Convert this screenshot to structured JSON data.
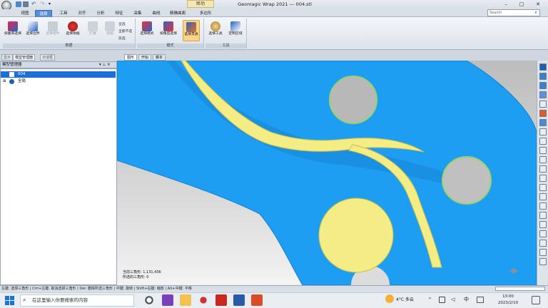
{
  "window": {
    "title": "Geomagic Wrap 2021 --- 004.stl",
    "context_tab": "赊功",
    "controls": [
      "–",
      "□",
      "✕"
    ]
  },
  "ribbon_tabs": [
    "视图",
    "选择",
    "工具",
    "对齐",
    "分析",
    "特征",
    "采集",
    "曲线",
    "精确曲面",
    "多边形"
  ],
  "active_tab": "选择",
  "search": {
    "placeholder": "Search"
  },
  "ribbon": {
    "groups": [
      {
        "label": "数据",
        "buttons": [
          "按曲率选择",
          "选择边界",
          "选择组件",
          "选择依据",
          "扩展",
          "收缩"
        ],
        "small": [
          "全选",
          "全部不选",
          "反选"
        ]
      },
      {
        "label": "模式",
        "buttons": [
          "选择模式",
          "按角度选择",
          "选择贯通"
        ]
      },
      {
        "label": "工具",
        "buttons": [
          "选择工具",
          "定制区域"
        ]
      }
    ]
  },
  "left_panel": {
    "tabs": [
      "显示",
      "模型管理器",
      "对话框"
    ],
    "header": "模型管理器",
    "items": [
      {
        "label": "004",
        "selected": true
      },
      {
        "label": "全局",
        "selected": false
      }
    ]
  },
  "viewport": {
    "tabs": [
      "图形",
      "开始",
      "脚本"
    ],
    "info": [
      "当前三角形: 1,131,436",
      "所选的三角形: 0"
    ]
  },
  "statusbar": {
    "text": "左键: 选择三角形 | Ctrl+左键: 取消选择三角形 | Del: 删除所选三角形 | 中键: 旋转 | Shift+右键: 缩放 | Alt+中键: 平移"
  },
  "taskbar": {
    "search_placeholder": "在这里输入你要搜索的内容",
    "weather": "4°C 多云",
    "time": "13:00",
    "date": "2023/2/10"
  },
  "colors": {
    "mesh": "#1e9ef2",
    "selected": "#f4ec84",
    "ribbon_active": "#5a8ed2",
    "tree_selected": "#1c6fd9"
  }
}
